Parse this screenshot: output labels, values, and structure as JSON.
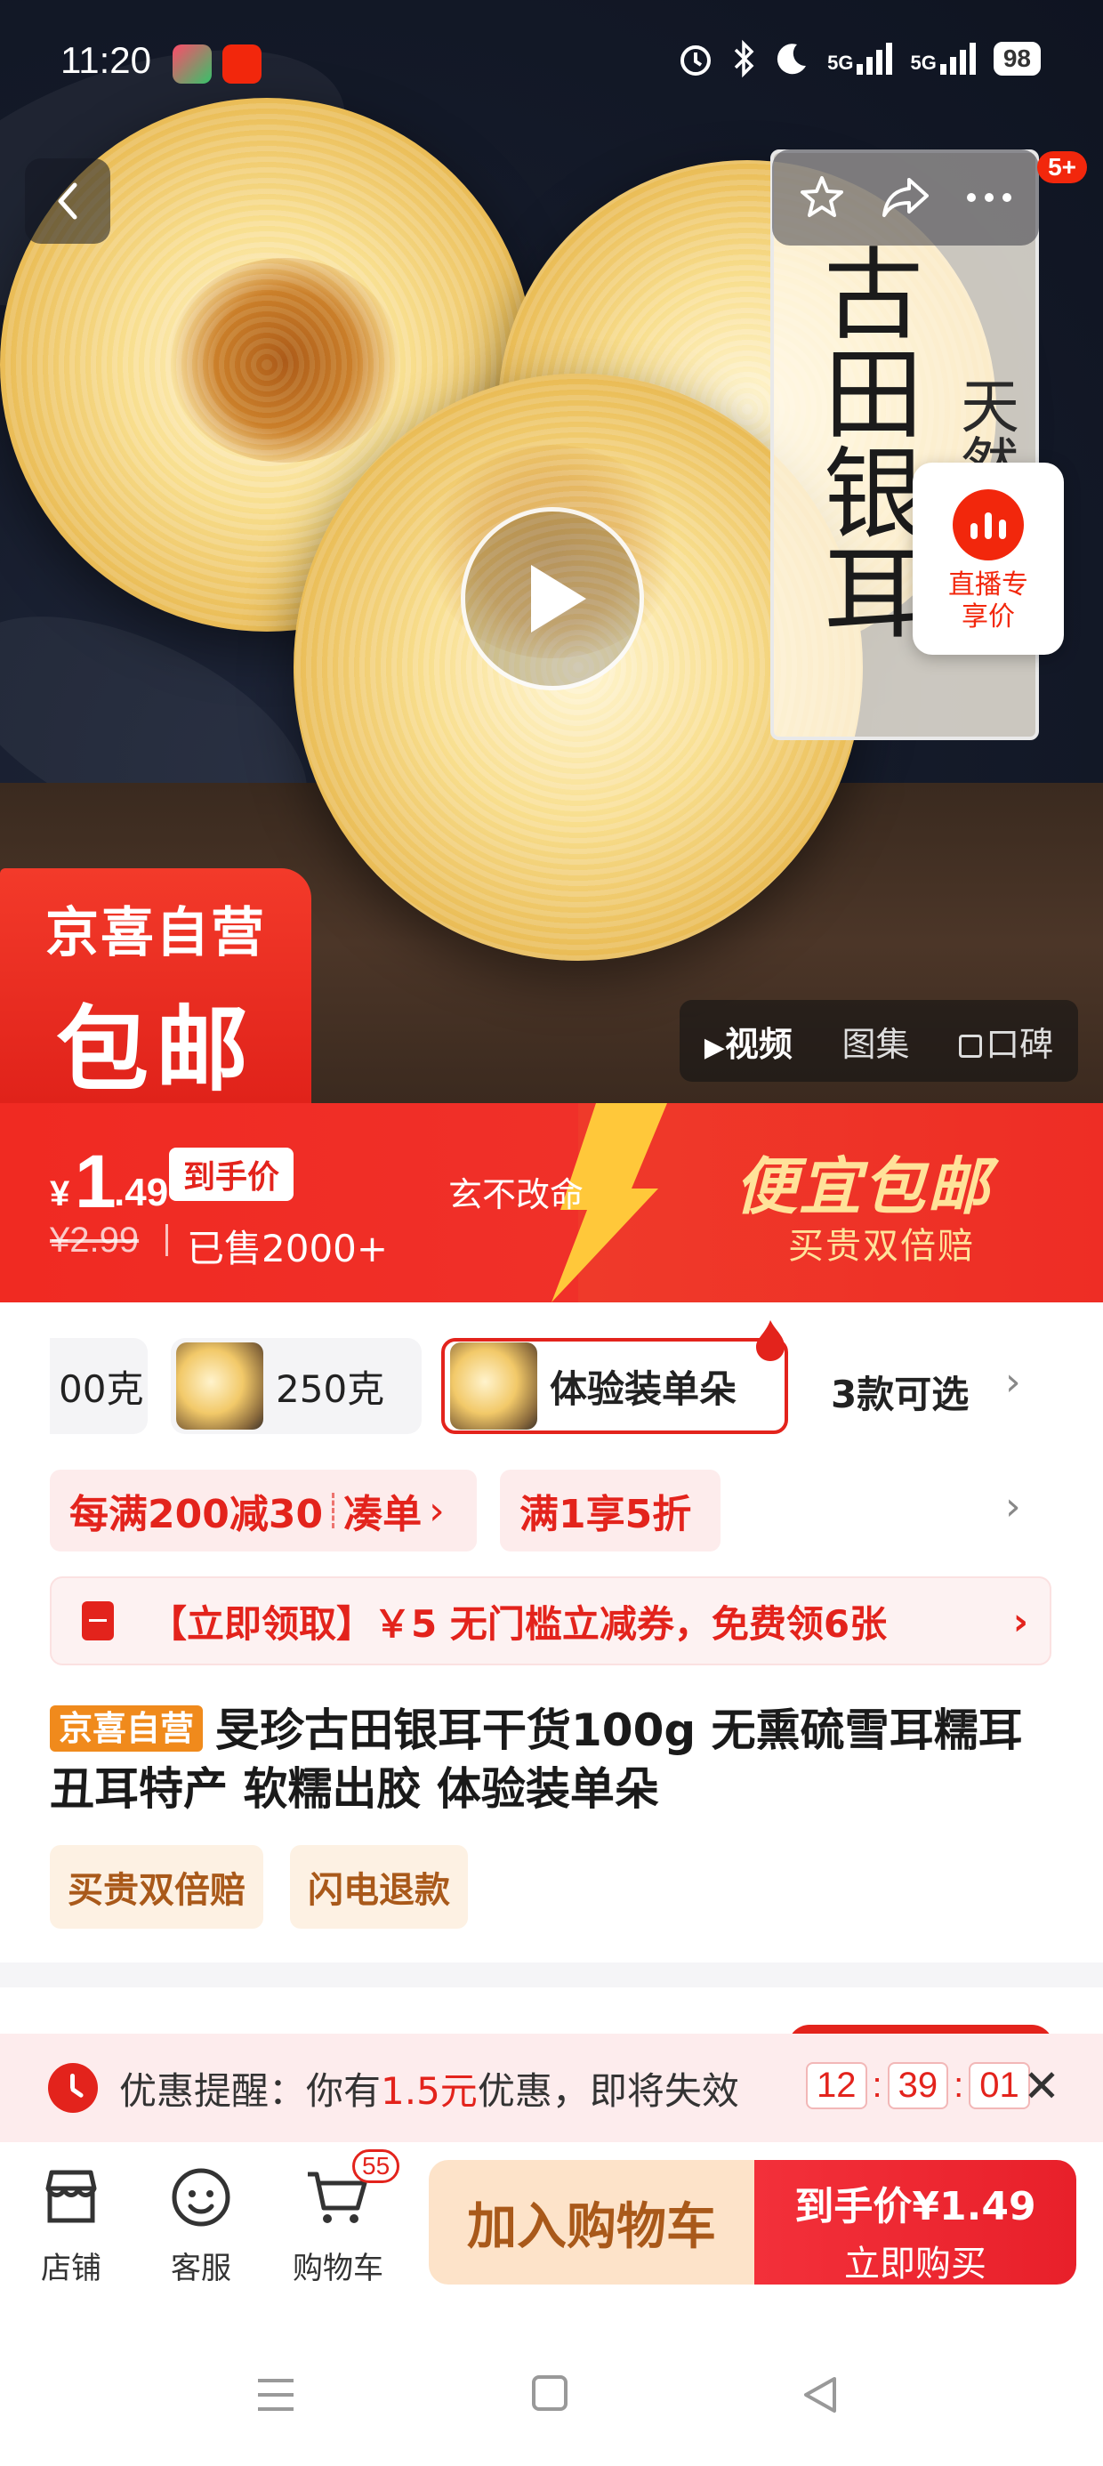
{
  "status_bar": {
    "time": "11:20",
    "network_1": "5G",
    "network_2": "5G",
    "battery": "98"
  },
  "top_bar": {
    "notification_count": "5+"
  },
  "hero": {
    "label_big": "古田银耳",
    "label_small": "天然无硫",
    "live_label": "直播专享价",
    "promo_line1": "京喜自营",
    "promo_line2": "包邮",
    "media_tabs": [
      "视频",
      "图集",
      "口碑"
    ]
  },
  "price": {
    "currency": "¥",
    "integer": "1",
    "decimal": ".49",
    "tag": "到手价",
    "original": "¥2.99",
    "sold": "已售2000+",
    "slogan": "玄不改命",
    "banner_title": "便宜包邮",
    "banner_sub": "买贵双倍赔"
  },
  "sku": {
    "options": [
      {
        "label": "00克"
      },
      {
        "label": "250克"
      },
      {
        "label": "体验装单朵"
      }
    ],
    "more": "3款可选"
  },
  "promos": {
    "tag1_main": "每满200减30",
    "tag1_action": "凑单",
    "tag2": "满1享5折",
    "coupon": "【立即领取】￥5 无门槛立减券，免费领6张"
  },
  "title": {
    "badge": "京喜自营",
    "text": "旻珍古田银耳干货100g 无熏硫雪耳糯耳丑耳特产 软糯出胶 体验装单朵"
  },
  "services": [
    "买贵双倍赔",
    "闪电退款"
  ],
  "reminder": {
    "prefix": "优惠提醒：你有",
    "amount": "1.5元",
    "suffix": "优惠，即将失效",
    "hh": "12",
    "mm": "39",
    "ss": "01"
  },
  "bottom_bar": {
    "store": "店铺",
    "service": "客服",
    "cart": "购物车",
    "cart_count": "55",
    "add_cart": "加入购物车",
    "buy_line1": "到手价¥1.49",
    "buy_line2": "立即购买"
  },
  "colors": {
    "brand_red": "#e3231c",
    "promo_gold": "#ffe29a",
    "self_operated_orange": "#f08a1c"
  },
  "icons": [
    "back-icon",
    "star-icon",
    "share-icon",
    "more-icon",
    "play-icon",
    "live-icon",
    "coupon-icon",
    "clock-icon",
    "close-icon",
    "store-icon",
    "service-icon",
    "cart-icon",
    "menu-nav-icon",
    "home-nav-icon",
    "back-nav-icon"
  ]
}
